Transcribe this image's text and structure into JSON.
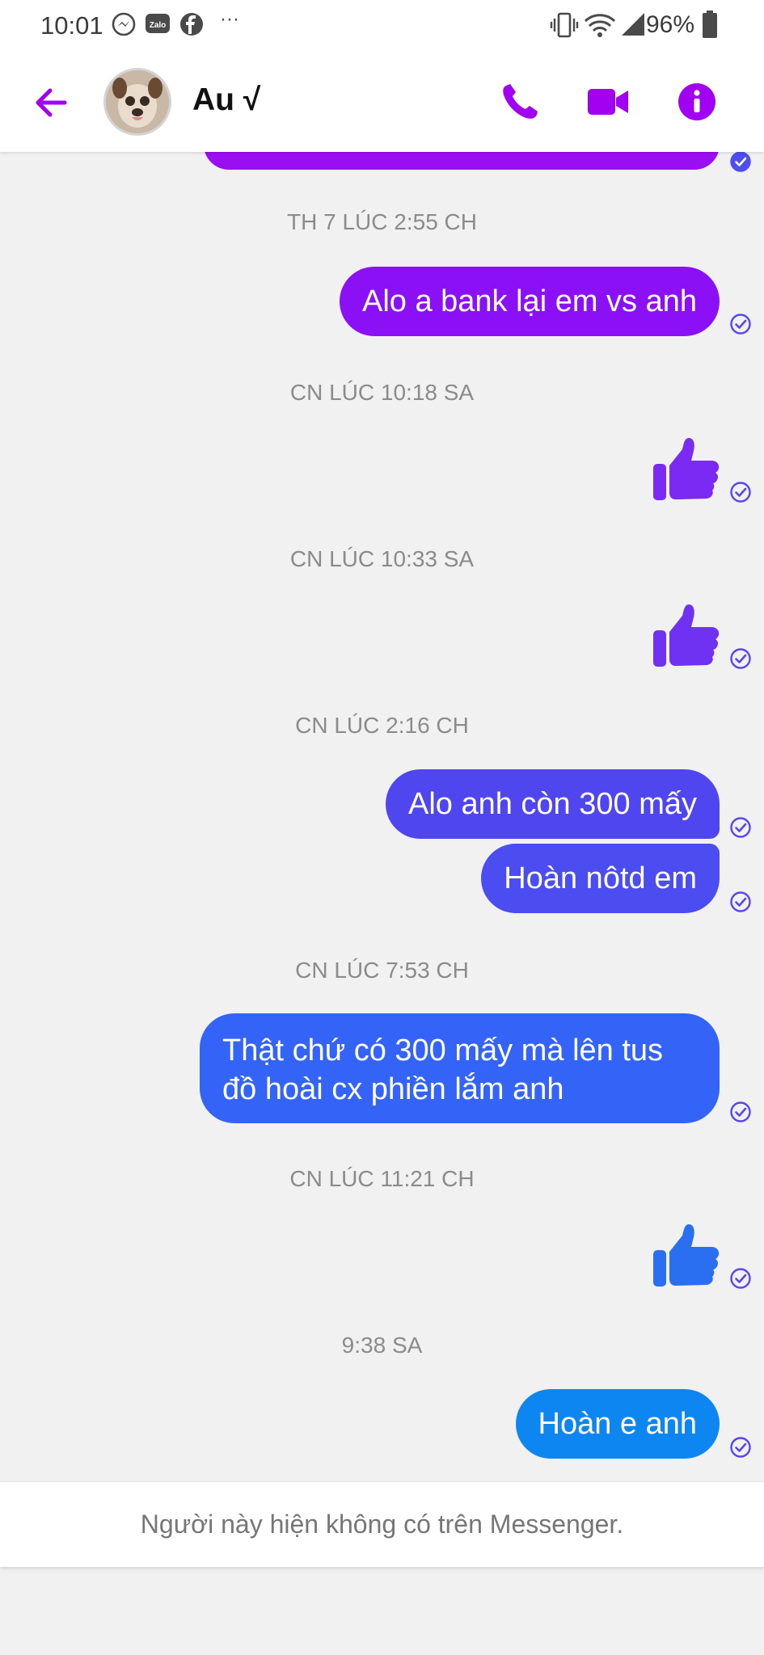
{
  "status_bar": {
    "time": "10:01",
    "battery": "96%",
    "overflow": "···"
  },
  "header": {
    "contact_name": "Au √",
    "accent_color": "#a100f2"
  },
  "messages": [
    {
      "type": "timestamp",
      "text": "TH 7 LÚC 2:55 CH"
    },
    {
      "type": "outgoing",
      "text": "Alo a bank lại em vs anh",
      "color": "#8b10f5"
    },
    {
      "type": "timestamp",
      "text": "CN LÚC 10:18 SA"
    },
    {
      "type": "like",
      "color": "#7a2af2"
    },
    {
      "type": "timestamp",
      "text": "CN LÚC 10:33 SA"
    },
    {
      "type": "like",
      "color": "#6f32f3"
    },
    {
      "type": "timestamp",
      "text": "CN LÚC 2:16 CH"
    },
    {
      "type": "outgoing",
      "text": "Alo anh còn 300 mấy",
      "color": "#4f46f0"
    },
    {
      "type": "outgoing",
      "text": "Hoàn nôtd em",
      "color": "#4b4df1"
    },
    {
      "type": "timestamp",
      "text": "CN LÚC 7:53 CH"
    },
    {
      "type": "outgoing",
      "text": "Thật chứ có 300 mấy mà lên tus đồ hoài cx phiền lắm anh",
      "color": "#3364f7"
    },
    {
      "type": "timestamp",
      "text": "CN LÚC 11:21 CH"
    },
    {
      "type": "like",
      "color": "#2a6ff0"
    },
    {
      "type": "timestamp",
      "text": "9:38 SA"
    },
    {
      "type": "outgoing",
      "text": "Hoàn e anh",
      "color": "#0d86f2"
    }
  ],
  "footer": {
    "notice": "Người này hiện không có trên Messenger."
  }
}
